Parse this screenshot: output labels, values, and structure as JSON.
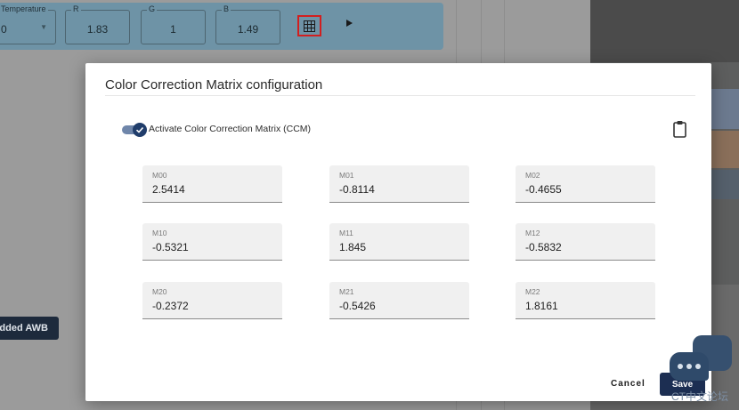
{
  "toolbar": {
    "fields": [
      {
        "label": "Temperature",
        "value": "0"
      },
      {
        "label": "R",
        "value": "1.83"
      },
      {
        "label": "G",
        "value": "1"
      },
      {
        "label": "B",
        "value": "1.49"
      }
    ],
    "grid_icon": "grid-table-icon",
    "play_icon": "play-icon"
  },
  "background": {
    "awb_button_label": "Embedded AWB"
  },
  "dialog": {
    "title": "Color Correction Matrix configuration",
    "activate_label": "Activate Color Correction Matrix (CCM)",
    "activate_enabled": true,
    "clipboard_icon": "clipboard-icon",
    "matrix": [
      [
        {
          "label": "M00",
          "value": "2.5414"
        },
        {
          "label": "M01",
          "value": "-0.8114"
        },
        {
          "label": "M02",
          "value": "-0.4655"
        }
      ],
      [
        {
          "label": "M10",
          "value": "-0.5321"
        },
        {
          "label": "M11",
          "value": "1.845"
        },
        {
          "label": "M12",
          "value": "-0.5832"
        }
      ],
      [
        {
          "label": "M20",
          "value": "-0.2372"
        },
        {
          "label": "M21",
          "value": "-0.5426"
        },
        {
          "label": "M22",
          "value": "1.8161"
        }
      ]
    ],
    "cancel_label": "Cancel",
    "save_label": "Save"
  },
  "overlay": {
    "chat_icon": "chat-bubbles-icon",
    "forum_text": "CT中文论坛"
  },
  "colors": {
    "toolbar_bg": "#6e93a6",
    "primary": "#1c2e52",
    "highlight": "#d21f1f"
  }
}
